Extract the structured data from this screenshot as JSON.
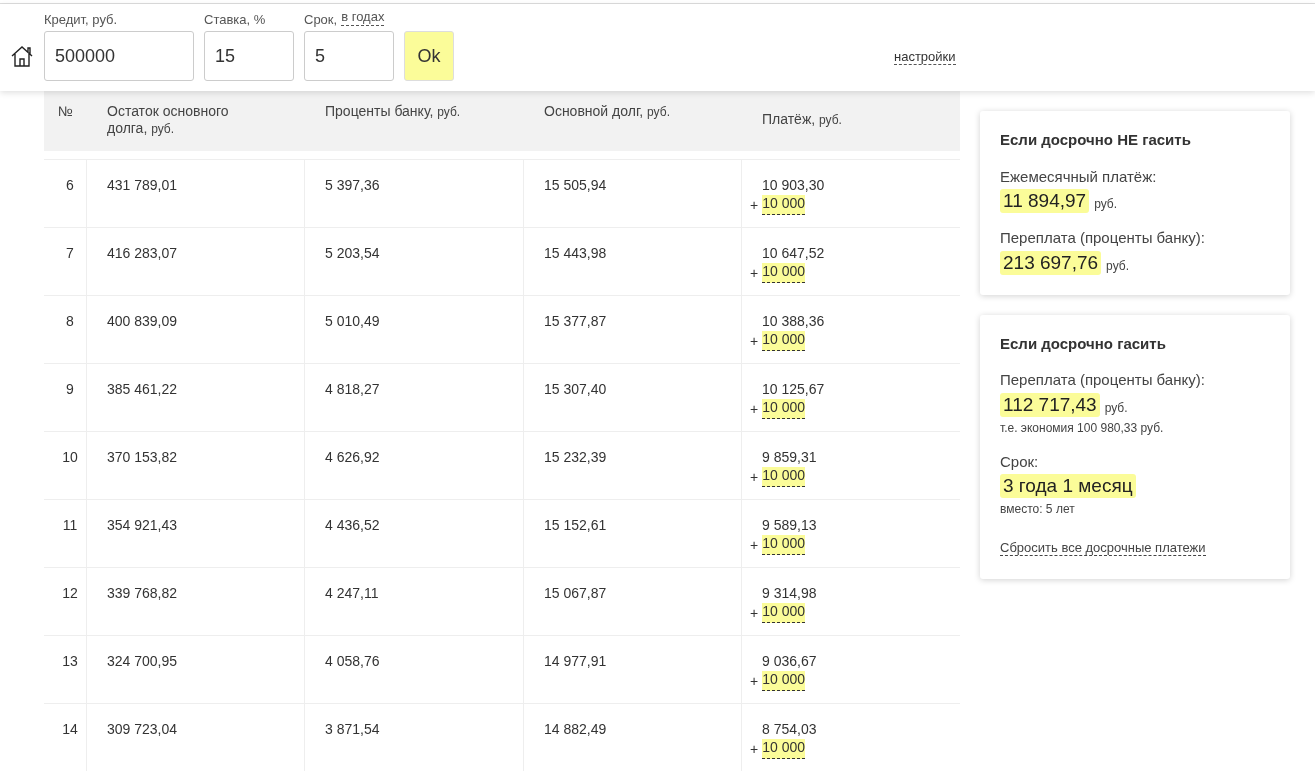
{
  "form": {
    "fields": [
      {
        "label": "Кредит, руб.",
        "value": "500000"
      },
      {
        "label": "Ставка, %",
        "value": "15"
      },
      {
        "label": "Срок,",
        "link": "в годах",
        "value": "5"
      }
    ],
    "submit": "Ok",
    "settings_link": "настройки"
  },
  "table": {
    "columns": [
      {
        "label": "№"
      },
      {
        "label": "Остаток основного долга,",
        "unit": "руб."
      },
      {
        "label": "Проценты банку,",
        "unit": "руб."
      },
      {
        "label": "Основной долг,",
        "unit": "руб."
      },
      {
        "label": "Платёж,",
        "unit": "руб."
      }
    ],
    "rows": [
      {
        "n": "6",
        "balance": "431 789,01",
        "interest": "5 397,36",
        "principal": "15 505,94",
        "payment": "10 903,30",
        "extra_sign": "+",
        "extra": "10 000"
      },
      {
        "n": "7",
        "balance": "416 283,07",
        "interest": "5 203,54",
        "principal": "15 443,98",
        "payment": "10 647,52",
        "extra_sign": "+",
        "extra": "10 000"
      },
      {
        "n": "8",
        "balance": "400 839,09",
        "interest": "5 010,49",
        "principal": "15 377,87",
        "payment": "10 388,36",
        "extra_sign": "+",
        "extra": "10 000"
      },
      {
        "n": "9",
        "balance": "385 461,22",
        "interest": "4 818,27",
        "principal": "15 307,40",
        "payment": "10 125,67",
        "extra_sign": "+",
        "extra": "10 000"
      },
      {
        "n": "10",
        "balance": "370 153,82",
        "interest": "4 626,92",
        "principal": "15 232,39",
        "payment": "9 859,31",
        "extra_sign": "+",
        "extra": "10 000"
      },
      {
        "n": "11",
        "balance": "354 921,43",
        "interest": "4 436,52",
        "principal": "15 152,61",
        "payment": "9 589,13",
        "extra_sign": "+",
        "extra": "10 000"
      },
      {
        "n": "12",
        "balance": "339 768,82",
        "interest": "4 247,11",
        "principal": "15 067,87",
        "payment": "9 314,98",
        "extra_sign": "+",
        "extra": "10 000"
      },
      {
        "n": "13",
        "balance": "324 700,95",
        "interest": "4 058,76",
        "principal": "14 977,91",
        "payment": "9 036,67",
        "extra_sign": "+",
        "extra": "10 000"
      },
      {
        "n": "14",
        "balance": "309 723,04",
        "interest": "3 871,54",
        "principal": "14 882,49",
        "payment": "8 754,03",
        "extra_sign": "+",
        "extra": "10 000"
      }
    ]
  },
  "summary_cards": [
    {
      "title": "Если досрочно НЕ гасить",
      "items": [
        {
          "label": "Ежемесячный платёж:",
          "value": "11 894,97",
          "unit": "руб."
        },
        {
          "label": "Переплата (проценты банку):",
          "value": "213 697,76",
          "unit": "руб."
        }
      ]
    },
    {
      "title": "Если досрочно гасить",
      "items": [
        {
          "label": "Переплата (проценты банку):",
          "value": "112 717,43",
          "unit": "руб.",
          "note": "т.е. экономия 100 980,33 руб."
        },
        {
          "label": "Срок:",
          "value": "3 года 1 месяц",
          "note": "вместо: 5 лет"
        }
      ],
      "link": "Сбросить все досрочные платежи"
    }
  ]
}
